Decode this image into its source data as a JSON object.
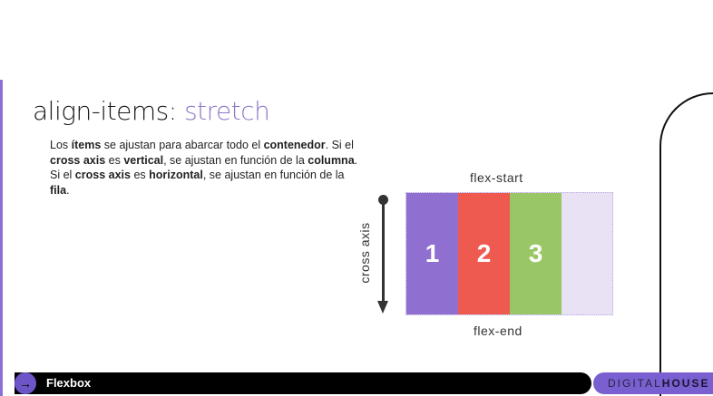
{
  "title": {
    "prefix": "align-items: ",
    "value": "stretch"
  },
  "description": [
    {
      "t": "Los ",
      "b": false
    },
    {
      "t": "ítems",
      "b": true
    },
    {
      "t": " se ajustan para abarcar todo el ",
      "b": false
    },
    {
      "t": "contenedor",
      "b": true
    },
    {
      "t": ". Si el ",
      "b": false
    },
    {
      "t": "cross axis",
      "b": true
    },
    {
      "t": " es ",
      "b": false
    },
    {
      "t": "vertical",
      "b": true
    },
    {
      "t": ", se ajustan en función de la ",
      "b": false
    },
    {
      "t": "columna",
      "b": true
    },
    {
      "t": ". Si el ",
      "b": false
    },
    {
      "t": "cross axis",
      "b": true
    },
    {
      "t": " es ",
      "b": false
    },
    {
      "t": "horizontal",
      "b": true
    },
    {
      "t": ", se ajustan en función de la ",
      "b": false
    },
    {
      "t": "fila",
      "b": true
    },
    {
      "t": ".",
      "b": false
    }
  ],
  "diagram": {
    "top_label": "flex-start",
    "bottom_label": "flex-end",
    "axis_label": "cross axis",
    "items": [
      {
        "label": "1",
        "color": "#8f6fcf"
      },
      {
        "label": "2",
        "color": "#ef5a50"
      },
      {
        "label": "3",
        "color": "#9ac766"
      }
    ]
  },
  "footer": {
    "label": "Flexbox",
    "icon": "arrow-right-icon",
    "arrow": "→"
  },
  "brand": {
    "light": "DIGITAL",
    "bold": "HOUSE"
  }
}
